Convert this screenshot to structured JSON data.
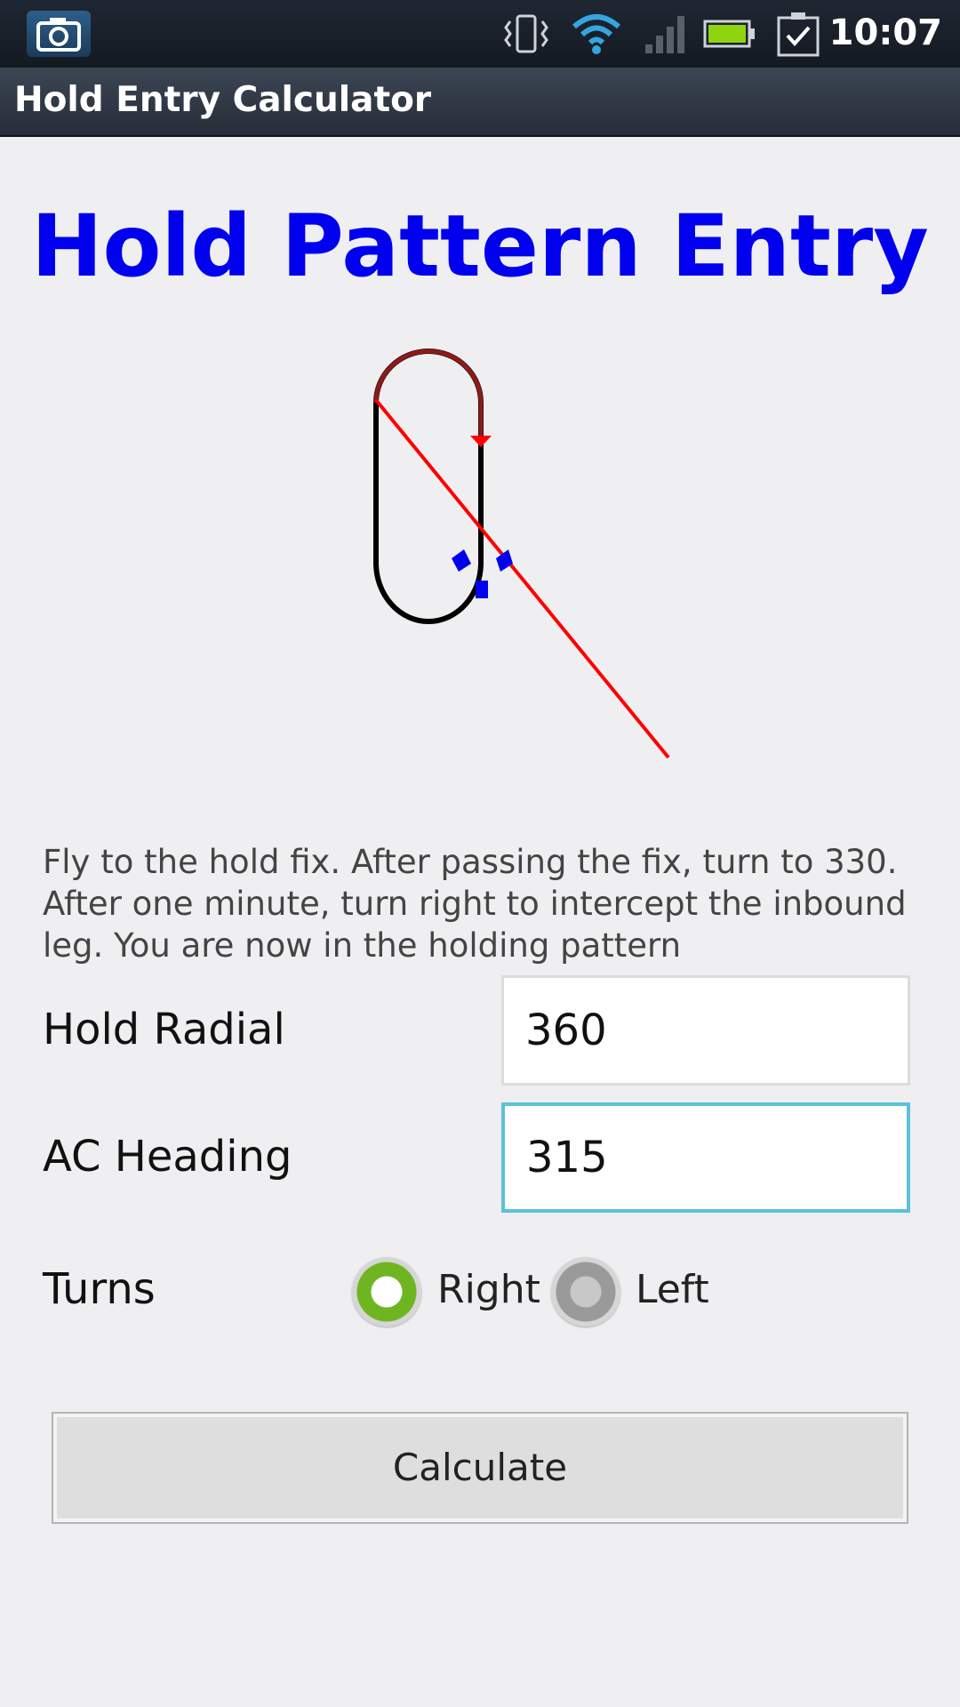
{
  "status_bar": {
    "time": "10:07",
    "icons": [
      "camera-icon",
      "vibrate-icon",
      "wifi-icon",
      "signal-icon",
      "battery-icon",
      "task-check-icon"
    ]
  },
  "app_bar": {
    "title": "Hold Entry Calculator"
  },
  "main": {
    "heading": "Hold Pattern Entry",
    "instructions": "Fly to the hold fix. After passing the fix, turn to 330. After one minute, turn right to intercept the inbound leg. You are now in the holding pattern",
    "fields": {
      "hold_radial_label": "Hold Radial",
      "hold_radial_value": "360",
      "ac_heading_label": "AC Heading",
      "ac_heading_value": "315"
    },
    "turns": {
      "label": "Turns",
      "right_label": "Right",
      "left_label": "Left",
      "selected": "Right"
    },
    "calculate_label": "Calculate"
  },
  "colors": {
    "heading": "#0000ee",
    "path": "#ff0000",
    "pattern": "#000000",
    "aircraft": "#0000ee",
    "radio_checked": "#6fb521",
    "focus_border": "#5bc2db"
  }
}
